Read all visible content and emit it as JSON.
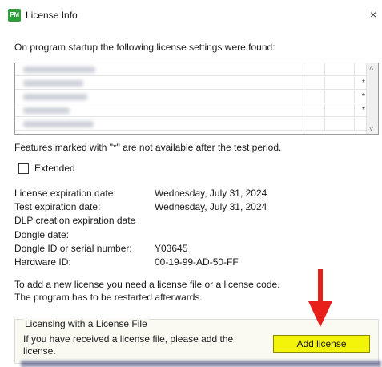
{
  "window": {
    "title": "License Info",
    "app_icon_text": "PM",
    "close_glyph": "×"
  },
  "intro_text": "On program startup the following license settings were found:",
  "license_list": {
    "rows": [
      {
        "name": "",
        "marker": ""
      },
      {
        "name": "",
        "marker": "*"
      },
      {
        "name": "",
        "marker": "*"
      },
      {
        "name": "",
        "marker": "*"
      },
      {
        "name": "",
        "marker": ""
      }
    ],
    "scroll_up": "˄",
    "scroll_down": "˅"
  },
  "features_note": "Features marked with \"*\" are not available after the test period.",
  "extended_checkbox": {
    "label": "Extended",
    "checked": false
  },
  "info": [
    {
      "label": "License expiration date:",
      "value": "Wednesday, July 31, 2024"
    },
    {
      "label": "Test expiration date:",
      "value": "Wednesday, July 31, 2024"
    },
    {
      "label": "DLP creation expiration date",
      "value": ""
    },
    {
      "label": "Dongle date:",
      "value": ""
    },
    {
      "label": "Dongle ID or serial number:",
      "value": "Y03645"
    },
    {
      "label": "Hardware ID:",
      "value": "00-19-99-AD-50-FF"
    }
  ],
  "license_note": [
    "To add a new license you need a license file or a license code.",
    "The program has to be restarted afterwards."
  ],
  "license_file_group": {
    "title": "Licensing with a License File",
    "text": "If you have received a license file, please add the license.",
    "button_label": "Add license"
  },
  "colors": {
    "button_bg": "#f4f40a",
    "arrow": "#e8201c",
    "app_icon": "#2e9e3a"
  }
}
